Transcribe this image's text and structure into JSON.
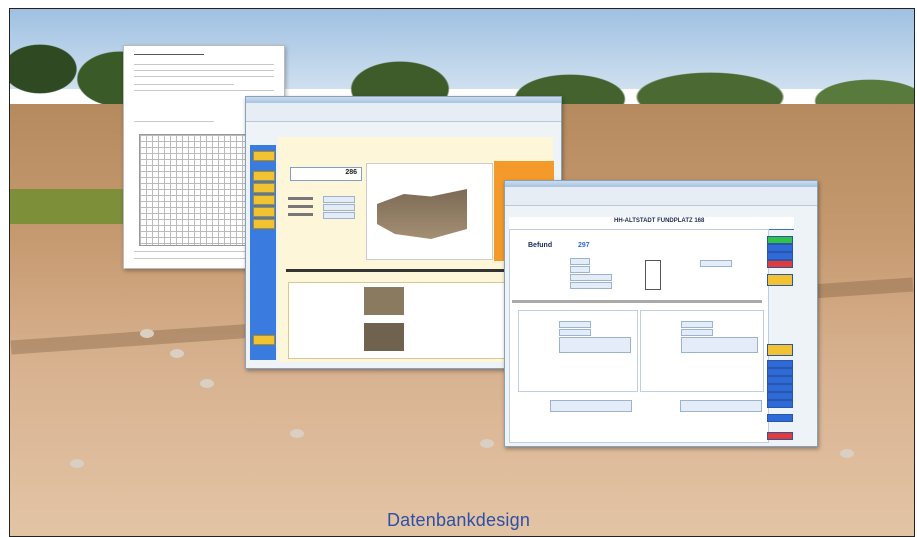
{
  "slide": {
    "caption": "Datenbankdesign"
  },
  "screenshot_windows": {
    "middle": {
      "record_number": "286"
    },
    "front": {
      "header": "HH-ALTSTADT FUNDPLATZ 168",
      "section_label": "Befund",
      "record_number": "297"
    }
  },
  "colors": {
    "caption": "#2e4fa8",
    "sidebar_blue": "#3a7be0",
    "button_yellow": "#f1c232",
    "panel_orange": "#f39a2a"
  }
}
